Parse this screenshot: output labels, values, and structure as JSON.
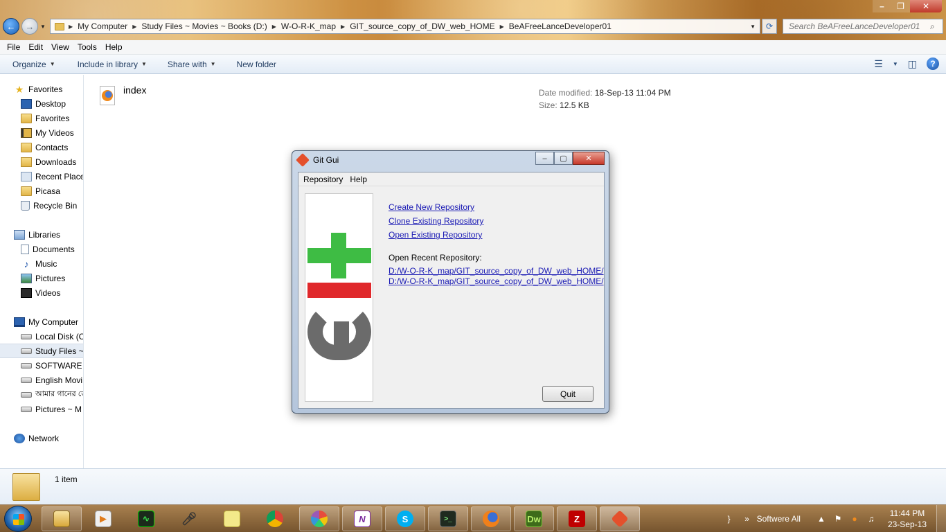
{
  "explorer": {
    "breadcrumbs": [
      "My Computer",
      "Study Files ~ Movies ~ Books (D:)",
      "W-O-R-K_map",
      "GIT_source_copy_of_DW_web_HOME",
      "BeAFreeLanceDeveloper01"
    ],
    "search_placeholder": "Search BeAFreeLanceDeveloper01",
    "menu": [
      "File",
      "Edit",
      "View",
      "Tools",
      "Help"
    ],
    "commands": {
      "organize": "Organize",
      "include_in_library": "Include in library",
      "share_with": "Share with",
      "new_folder": "New folder"
    },
    "sidebar": {
      "favorites": {
        "label": "Favorites",
        "items": [
          "Desktop",
          "Favorites",
          "My Videos",
          "Contacts",
          "Downloads",
          "Recent Place",
          "Picasa",
          "Recycle Bin"
        ]
      },
      "libraries": {
        "label": "Libraries",
        "items": [
          "Documents",
          "Music",
          "Pictures",
          "Videos"
        ]
      },
      "computer": {
        "label": "My Computer",
        "items": [
          "Local Disk (C",
          "Study Files ~",
          "SOFTWARE (",
          "English Movi",
          "আমার গানের জে",
          "Pictures ~ M"
        ]
      },
      "network": {
        "label": "Network"
      }
    },
    "file": {
      "name": "index",
      "date_label": "Date modified:",
      "date_value": "18-Sep-13 11:04 PM",
      "size_label": "Size:",
      "size_value": "12.5 KB"
    },
    "details": {
      "count": "1 item"
    }
  },
  "git_gui": {
    "title": "Git Gui",
    "menu": [
      "Repository",
      "Help"
    ],
    "actions": [
      "Create New Repository",
      "Clone Existing Repository",
      "Open Existing Repository"
    ],
    "recent_label": "Open Recent Repository:",
    "recent": [
      "D:/W-O-R-K_map/GIT_source_copy_of_DW_web_HOME/",
      "D:/W-O-R-K_map/GIT_source_copy_of_DW_web_HOME/"
    ],
    "quit": "Quit"
  },
  "taskbar": {
    "apps": [
      "explorer-icon",
      "media-player-icon",
      "audio-tool-icon",
      "microphone-icon",
      "sticky-notes-icon",
      "chrome-icon",
      "picasa-icon",
      "onenote-icon",
      "skype-icon",
      "terminal-icon",
      "firefox-icon",
      "dreamweaver-icon",
      "filezilla-icon",
      "git-icon"
    ],
    "dreamweaver_label": "Dw",
    "toolbar_name": "Softwere All",
    "time": "11:44 PM",
    "date": "23-Sep-13"
  }
}
